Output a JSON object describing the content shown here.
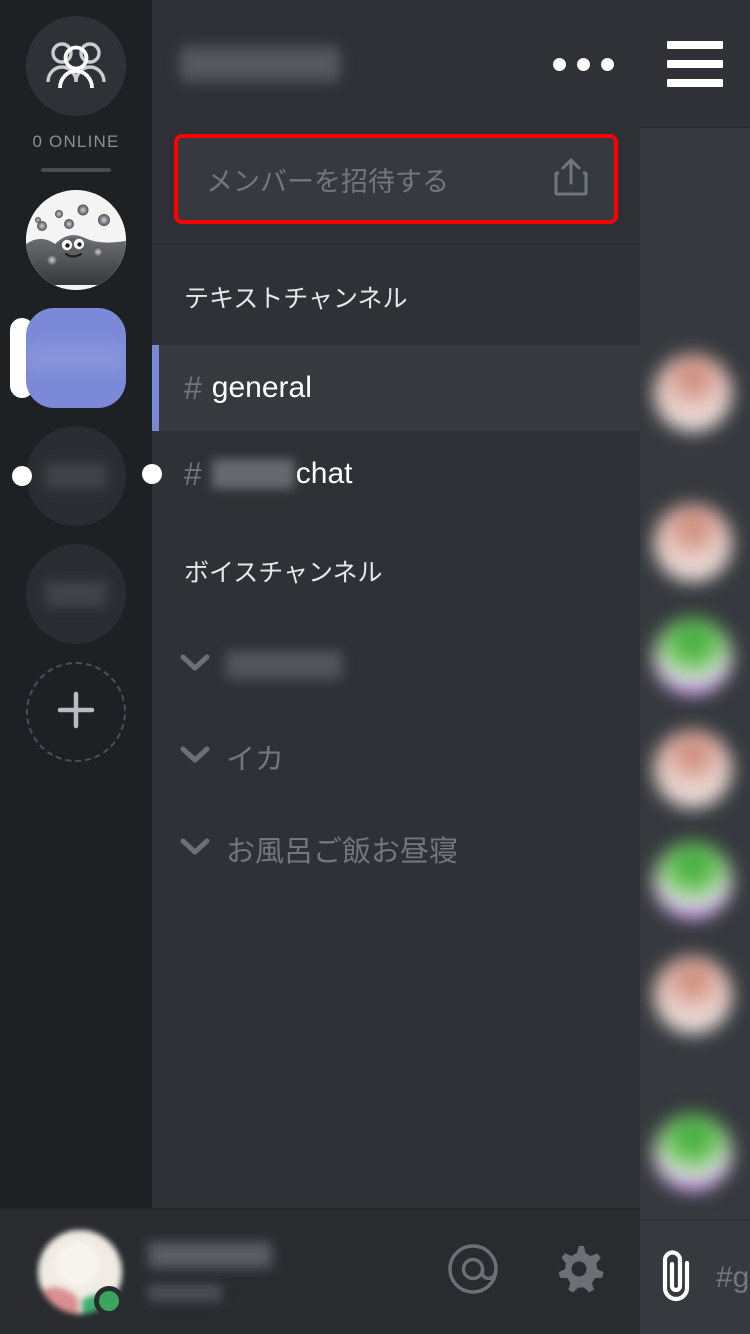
{
  "rail": {
    "home_icon": "friends-group-icon",
    "online_label": "0 ONLINE",
    "servers": [
      {
        "id": "slime",
        "name": "",
        "type": "image",
        "state": "idle",
        "icon": "slime-avatar"
      },
      {
        "id": "active",
        "name": "",
        "type": "blurred",
        "state": "selected",
        "icon": "server-icon-active"
      },
      {
        "id": "s2",
        "name": "",
        "type": "blurred",
        "state": "unread",
        "icon": "server-icon"
      },
      {
        "id": "s3",
        "name": "",
        "type": "blurred",
        "state": "idle",
        "icon": "server-icon"
      }
    ],
    "add_server_label": "+"
  },
  "panel": {
    "server_name": "",
    "more_options_icon": "three-dots-icon",
    "invite": {
      "placeholder": "メンバーを招待する",
      "share_icon": "share-icon",
      "highlight_color": "#ff0000"
    },
    "text_category": "テキストチャンネル",
    "text_channels": [
      {
        "hash": "#",
        "name": "general",
        "active": true,
        "unread": false
      },
      {
        "hash": "#",
        "name_suffix": "chat",
        "name_blurred": true,
        "active": false,
        "unread": true
      }
    ],
    "voice_category": "ボイスチャンネル",
    "voice_channels": [
      {
        "name": "",
        "blurred": true,
        "icon": "chevron-down-icon"
      },
      {
        "name": "イカ",
        "blurred": false,
        "icon": "chevron-down-icon"
      },
      {
        "name": "お風呂ご飯お昼寝",
        "blurred": false,
        "icon": "chevron-down-icon"
      }
    ]
  },
  "userbar": {
    "username": "",
    "discriminator": "",
    "status": "online",
    "status_color": "#3ba55d",
    "mention_icon": "at-icon",
    "settings_icon": "gear-icon"
  },
  "chat": {
    "menu_icon": "hamburger-menu-icon",
    "messages": [
      {
        "avatar": "avatar-a"
      },
      {
        "avatar": "avatar-a"
      },
      {
        "avatar": "avatar-b"
      },
      {
        "avatar": "avatar-a"
      },
      {
        "avatar": "avatar-b"
      },
      {
        "avatar": "avatar-a"
      },
      {
        "avatar": "avatar-b"
      }
    ],
    "attach_icon": "paperclip-icon",
    "input_placeholder": "#g"
  },
  "colors": {
    "rail_bg": "#1e2124",
    "panel_bg": "#2f3136",
    "chat_bg": "#36393e",
    "accent": "#7b89d8",
    "highlight": "#ff0000",
    "muted_text": "#72767d"
  }
}
